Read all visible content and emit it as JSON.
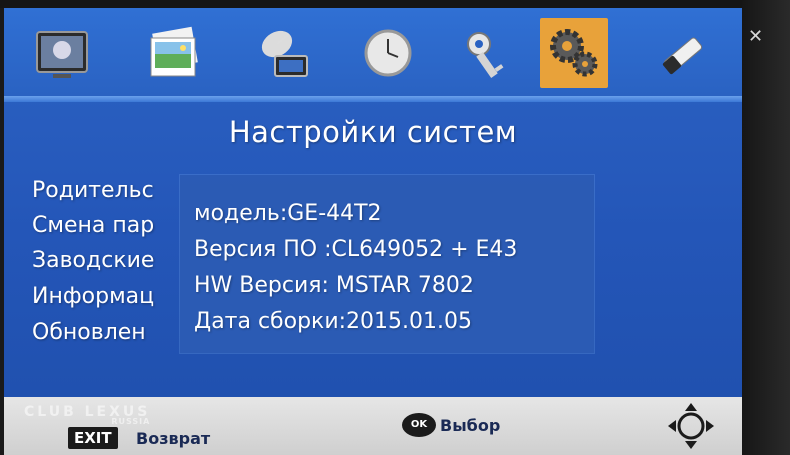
{
  "screen": {
    "title": "Настройки систем"
  },
  "iconbar": {
    "items": [
      {
        "icon": "tv-picture-icon"
      },
      {
        "icon": "image-icon"
      },
      {
        "icon": "satellite-dish-icon"
      },
      {
        "icon": "clock-icon"
      },
      {
        "icon": "key-lock-icon"
      },
      {
        "icon": "gear-settings-icon",
        "active": true
      },
      {
        "icon": "usb-drive-icon"
      }
    ],
    "active_color": "#e8a23a"
  },
  "menu": {
    "items": [
      "Родительс",
      "Смена пар",
      "Заводские",
      "Информац",
      "Обновлен"
    ]
  },
  "info": {
    "model": "модель:GE-44T2",
    "software": "Версия ПО :CL649052 + E43",
    "hardware": "HW Версия: MSTAR 7802",
    "build_date": "Дата сборки:2015.01.05"
  },
  "footer": {
    "exit_key": "EXIT",
    "exit_label": "Возврат",
    "ok_key": "OK",
    "ok_label": "Выбор"
  },
  "watermark": {
    "main": "CLUB LEXUS",
    "sub": "RUSSIA"
  },
  "colors": {
    "background": "#2456b8",
    "footer": "#d9d9d9",
    "text": "#ffffff"
  }
}
